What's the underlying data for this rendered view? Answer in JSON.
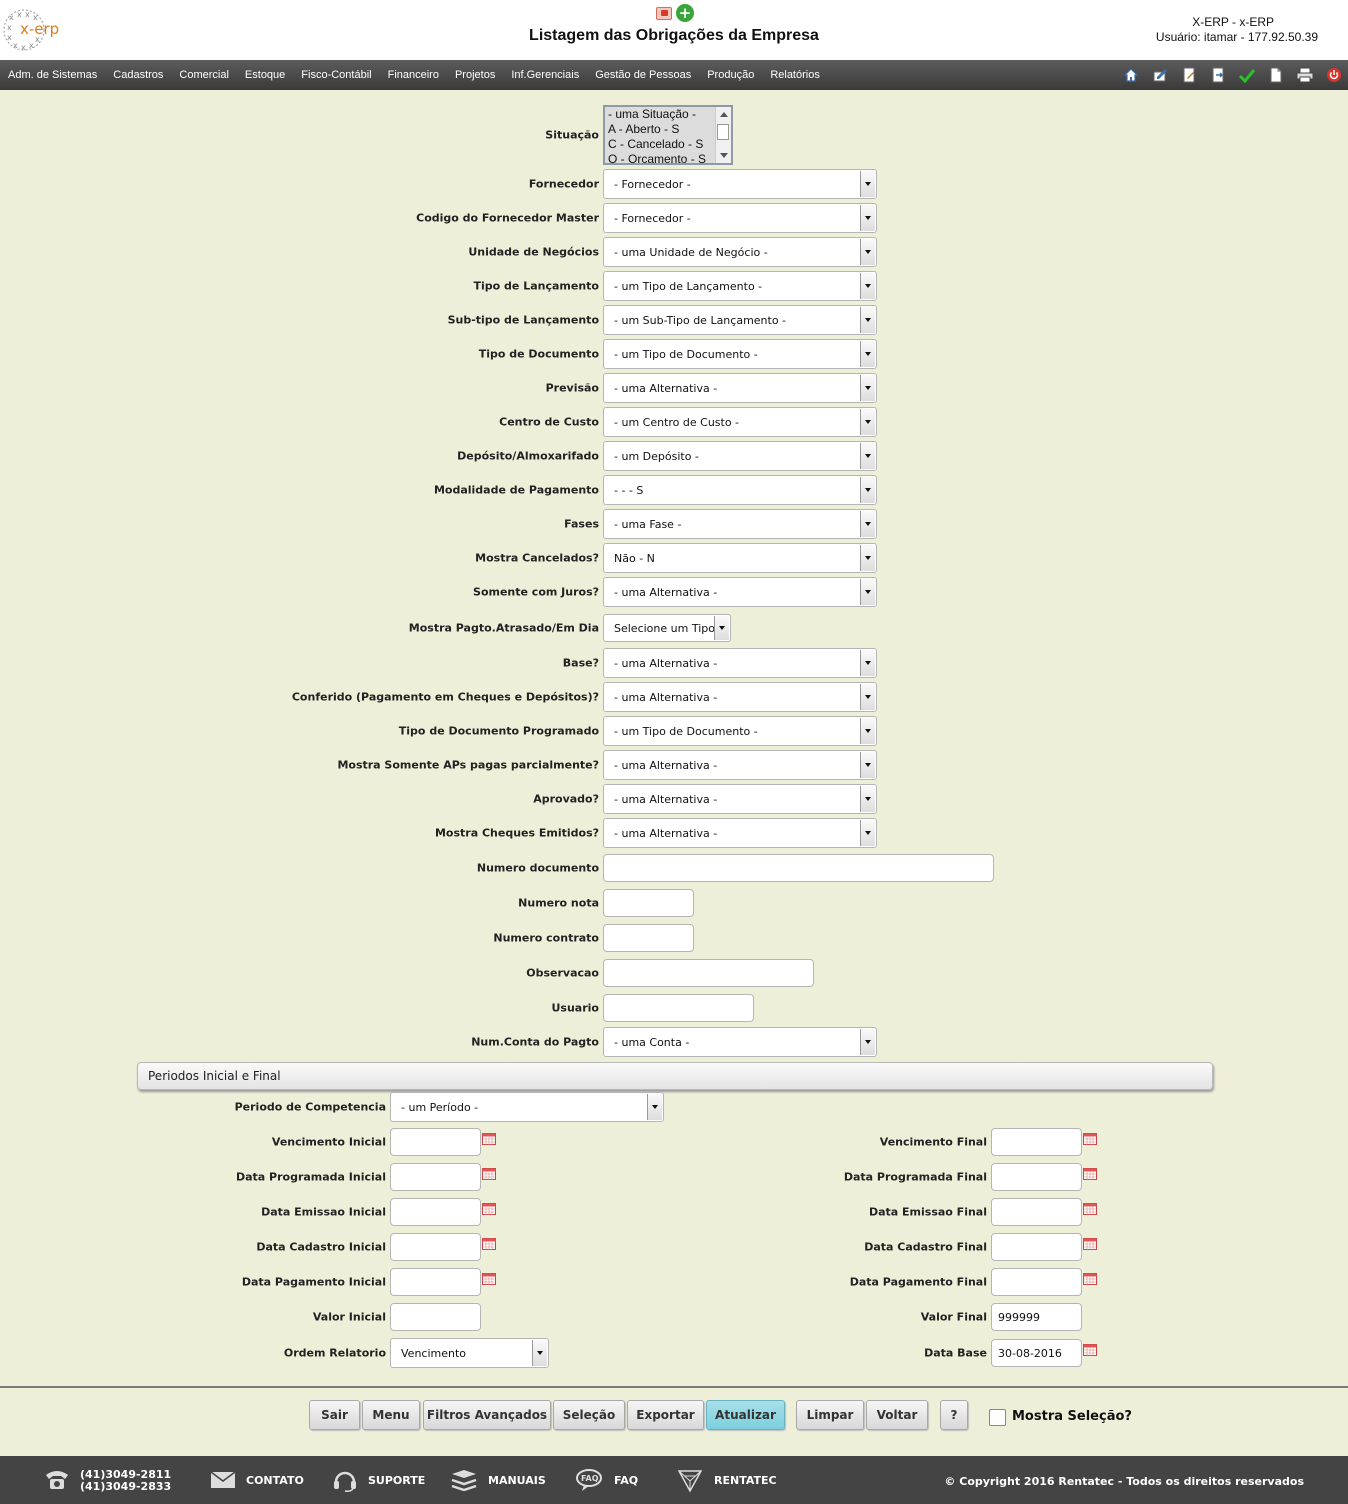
{
  "header": {
    "logo_text": "x-erp",
    "title": "Listagem das Obrigações da Empresa",
    "system": "X-ERP - x-ERP",
    "user": "Usuário: itamar - 177.92.50.39"
  },
  "menu": [
    "Adm. de Sistemas",
    "Cadastros",
    "Comercial",
    "Estoque",
    "Fisco-Contábil",
    "Financeiro",
    "Projetos",
    "Inf.Gerenciais",
    "Gestão de Pessoas",
    "Produção",
    "Relatórios"
  ],
  "toolbar_icons": [
    "home-icon",
    "edit-icon",
    "document-edit-icon",
    "export-document-icon",
    "check-icon",
    "new-document-icon",
    "print-icon",
    "power-icon"
  ],
  "situacao": {
    "label": "Situação",
    "options": [
      "- uma Situação -",
      "A - Aberto - S",
      "C - Cancelado - S",
      "O - Orcamento - S"
    ]
  },
  "fields": [
    {
      "label": "Fornecedor",
      "value": "- Fornecedor -"
    },
    {
      "label": "Codigo do Fornecedor Master",
      "value": "- Fornecedor -"
    },
    {
      "label": "Unidade de Negócios",
      "value": "- uma Unidade de Negócio -"
    },
    {
      "label": "Tipo de Lançamento",
      "value": "- um Tipo de Lançamento -"
    },
    {
      "label": "Sub-tipo de Lançamento",
      "value": "- um Sub-Tipo de Lançamento -"
    },
    {
      "label": "Tipo de Documento",
      "value": "- um Tipo de Documento -"
    },
    {
      "label": "Previsão",
      "value": "- uma Alternativa -"
    },
    {
      "label": "Centro de Custo",
      "value": "- um Centro de Custo -"
    },
    {
      "label": "Depósito/Almoxarifado",
      "value": "- um Depósito -"
    },
    {
      "label": "Modalidade de Pagamento",
      "value": "- - - S"
    },
    {
      "label": "Fases",
      "value": "- uma Fase -"
    },
    {
      "label": "Mostra Cancelados?",
      "value": "Não - N"
    },
    {
      "label": "Somente com Juros?",
      "value": "- uma Alternativa -"
    },
    {
      "label": "Mostra Pagto.Atrasado/Em Dia",
      "value": "Selecione um Tipo"
    },
    {
      "label": "Base?",
      "value": "- uma Alternativa -"
    },
    {
      "label": "Conferido (Pagamento em Cheques e Depósitos)?",
      "value": "- uma Alternativa -"
    },
    {
      "label": "Tipo de Documento Programado",
      "value": "- um Tipo de Documento -"
    },
    {
      "label": "Mostra Somente APs pagas parcialmente?",
      "value": "- uma Alternativa -"
    },
    {
      "label": "Aprovado?",
      "value": "- uma Alternativa -"
    },
    {
      "label": "Mostra Cheques Emitidos?",
      "value": "- uma Alternativa -"
    }
  ],
  "text_fields": [
    {
      "label": "Numero documento",
      "value": ""
    },
    {
      "label": "Numero nota",
      "value": ""
    },
    {
      "label": "Numero contrato",
      "value": ""
    },
    {
      "label": "Observacao",
      "value": ""
    },
    {
      "label": "Usuario",
      "value": ""
    }
  ],
  "conta": {
    "label": "Num.Conta do Pagto",
    "value": "- uma Conta -"
  },
  "periodos": {
    "section_title": "Periodos Inicial e Final",
    "competencia": {
      "label": "Periodo de Competencia",
      "value": "- um Período -"
    },
    "left": [
      {
        "label": "Vencimento Inicial",
        "value": ""
      },
      {
        "label": "Data Programada Inicial",
        "value": ""
      },
      {
        "label": "Data Emissao Inicial",
        "value": ""
      },
      {
        "label": "Data Cadastro Inicial",
        "value": ""
      },
      {
        "label": "Data Pagamento Inicial",
        "value": ""
      },
      {
        "label": "Valor Inicial",
        "value": ""
      }
    ],
    "right": [
      {
        "label": "Vencimento Final",
        "value": ""
      },
      {
        "label": "Data Programada Final",
        "value": ""
      },
      {
        "label": "Data Emissao Final",
        "value": ""
      },
      {
        "label": "Data Cadastro Final",
        "value": ""
      },
      {
        "label": "Data Pagamento Final",
        "value": ""
      },
      {
        "label": "Valor Final",
        "value": "999999"
      }
    ],
    "ordem": {
      "label": "Ordem Relatorio",
      "value": "Vencimento"
    },
    "data_base": {
      "label": "Data Base",
      "value": "30-08-2016"
    }
  },
  "buttons": [
    "Sair",
    "Menu",
    "Filtros Avançados",
    "Seleção",
    "Exportar",
    "Atualizar",
    "Limpar",
    "Voltar",
    "?"
  ],
  "mostra_selecao": "Mostra Seleção?",
  "footer": {
    "phone1": "(41)3049-2811",
    "phone2": "(41)3049-2833",
    "contato": "CONTATO",
    "suporte": "SUPORTE",
    "manuais": "MANUAIS",
    "faq": "FAQ",
    "rentatec": "RENTATEC",
    "copyright": "© Copyright 2016 Rentatec - Todos os direitos reservados"
  },
  "colors": {
    "background": "#eeefd9",
    "menubar": "#4a4a4a",
    "active_button": "#7ccfdd",
    "footer": "#444444",
    "logo_orange": "#e07b1a"
  }
}
